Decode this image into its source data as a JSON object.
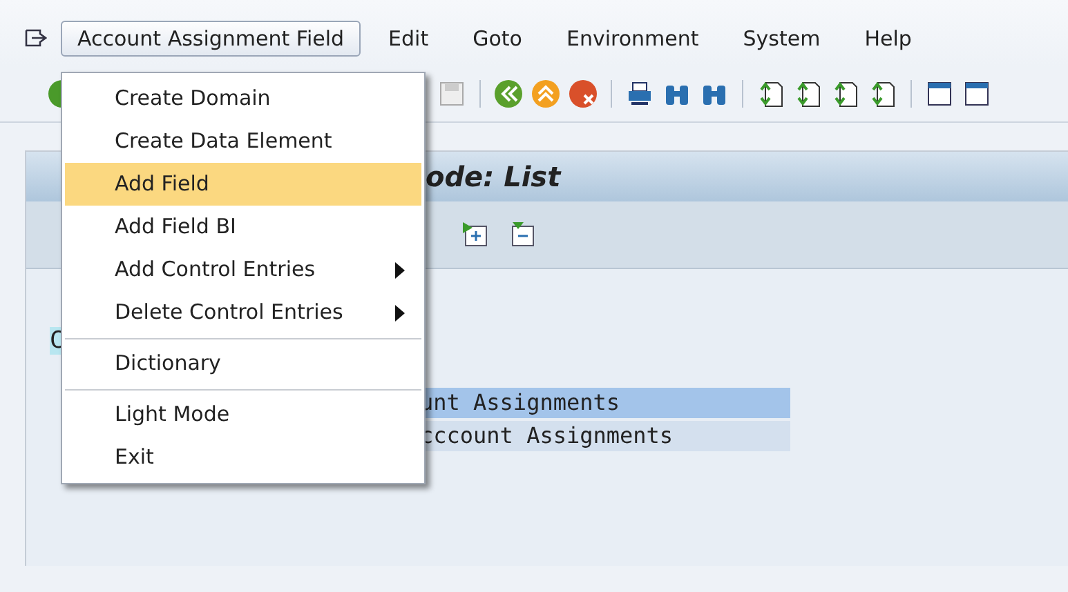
{
  "menubar": [
    {
      "label": "Account Assignment Field",
      "selected": true
    },
    {
      "label": "Edit",
      "selected": false
    },
    {
      "label": "Goto",
      "selected": false
    },
    {
      "label": "Environment",
      "selected": false
    },
    {
      "label": "System",
      "selected": false
    },
    {
      "label": "Help",
      "selected": false
    }
  ],
  "dropdown": [
    {
      "label": "Create Domain",
      "selected": false,
      "submenu": false,
      "separated": false
    },
    {
      "label": "Create Data Element",
      "selected": false,
      "submenu": false,
      "separated": false
    },
    {
      "label": "Add Field",
      "selected": true,
      "submenu": false,
      "separated": false
    },
    {
      "label": "Add Field BI",
      "selected": false,
      "submenu": false,
      "separated": false
    },
    {
      "label": "Add Control Entries",
      "selected": false,
      "submenu": true,
      "separated": false
    },
    {
      "label": "Delete Control Entries",
      "selected": false,
      "submenu": true,
      "separated": false
    },
    {
      "label": "Dictionary",
      "selected": false,
      "submenu": false,
      "separated": true
    },
    {
      "label": "Light Mode",
      "selected": false,
      "submenu": false,
      "separated": true
    },
    {
      "label": "Exit",
      "selected": false,
      "submenu": false,
      "separated": false
    }
  ],
  "screen": {
    "title": "ode: List",
    "first_line": "C",
    "rows": [
      {
        "text": "unt Assignments",
        "selected": true
      },
      {
        "text": "cccount Assignments",
        "selected": false
      }
    ]
  }
}
